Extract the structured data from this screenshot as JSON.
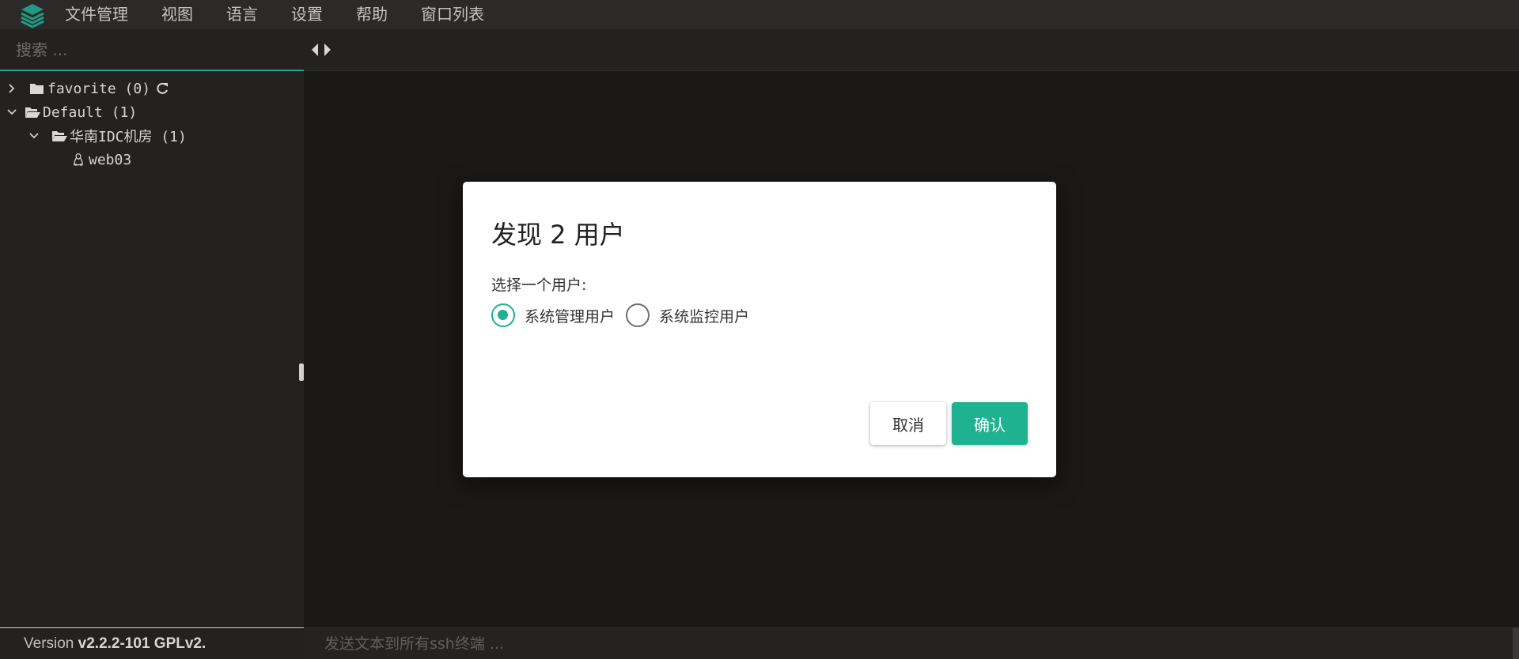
{
  "menu": {
    "items": [
      "文件管理",
      "视图",
      "语言",
      "设置",
      "帮助",
      "窗口列表"
    ]
  },
  "sidebar": {
    "search_placeholder": "搜索 ...",
    "tree": {
      "favorite": "favorite (0)",
      "default": "Default (1)",
      "group": "华南IDC机房 (1)",
      "host": "web03"
    },
    "version_prefix": "Version ",
    "version_value": "v2.2.2-101 GPLv2."
  },
  "main": {
    "broadcast_placeholder": "发送文本到所有ssh终端 ..."
  },
  "dialog": {
    "title": "发现 2 用户",
    "subtitle": "选择一个用户:",
    "options": [
      {
        "label": "系统管理用户",
        "selected": true
      },
      {
        "label": "系统监控用户",
        "selected": false
      }
    ],
    "cancel_label": "取消",
    "ok_label": "确认"
  },
  "colors": {
    "accent": "#1fb291",
    "background": "#1a1918",
    "panel": "#232221"
  },
  "icons": {
    "logo": "stack-logo-icon",
    "nav": [
      "arrow-left-icon",
      "arrow-right-icon"
    ],
    "tree": [
      "chevron-right-icon",
      "chevron-down-icon",
      "folder-icon",
      "folder-open-icon",
      "refresh-icon",
      "linux-icon"
    ]
  }
}
